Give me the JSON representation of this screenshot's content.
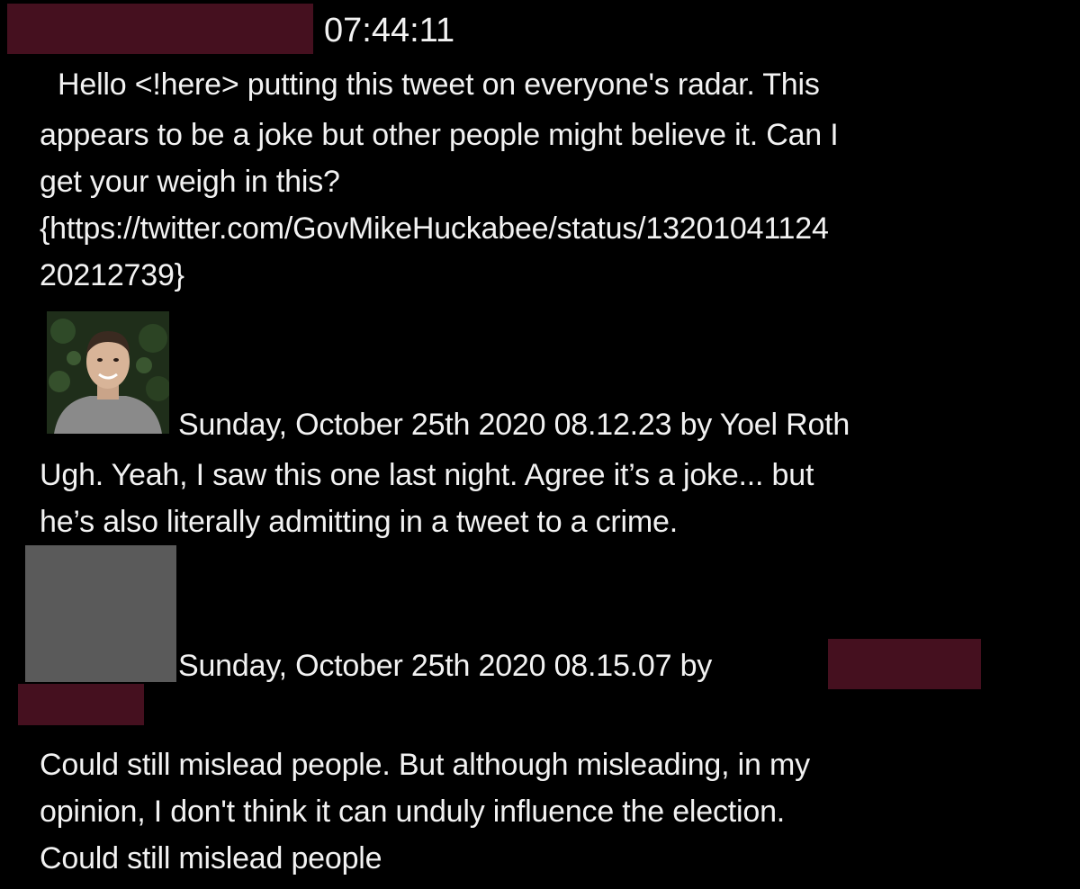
{
  "message_1": {
    "time": "07:44:11",
    "lines": [
      "Hello <!here> putting this tweet on everyone's radar. This",
      "appears to be a joke but other people might believe it. Can I",
      "get your weigh in this?",
      "{https://twitter.com/GovMikeHuckabee/status/13201041124",
      "20212739}"
    ]
  },
  "reply_1": {
    "meta": "Sunday, October 25th 2020 08.12.23 by Yoel Roth",
    "lines": [
      "Ugh. Yeah, I saw this one last night. Agree it’s a joke... but",
      "he’s also literally admitting in a tweet to a crime."
    ]
  },
  "reply_2": {
    "meta": "Sunday, October 25th 2020 08.15.07 by",
    "lines": [
      "Could still mislead people. But although misleading, in my",
      "opinion, I don't think it can unduly influence the election.",
      "Could still mislead people"
    ]
  },
  "colors": {
    "background": "#000000",
    "text": "#f2f2f2",
    "redaction": "#45101f",
    "placeholder_avatar": "#5a5a5a"
  }
}
